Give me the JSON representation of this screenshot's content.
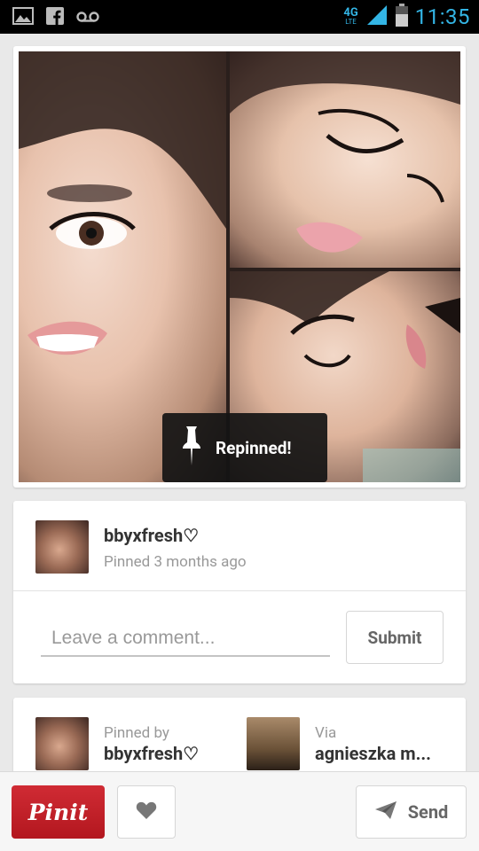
{
  "status_bar": {
    "network": "4G",
    "network_sub": "LTE",
    "time": "11:35",
    "left_icons": [
      "gallery-icon",
      "facebook-icon",
      "voicemail-icon"
    ],
    "accent_color": "#33b5e5"
  },
  "pin": {
    "image_alt": "makeup collage",
    "toast": {
      "label": "Repinned!",
      "icon": "pushpin-icon"
    }
  },
  "pinner": {
    "name": "bbyxfresh♡",
    "meta": "Pinned 3 months ago"
  },
  "comment": {
    "placeholder": "Leave a comment...",
    "submit_label": "Submit"
  },
  "attribution": {
    "pinned_by_label": "Pinned by",
    "pinned_by_name": "bbyxfresh♡",
    "via_label": "Via",
    "via_name": "agnieszka m..."
  },
  "actions": {
    "pinit_label": "Pinit",
    "send_label": "Send",
    "brand_color": "#c8232c"
  }
}
